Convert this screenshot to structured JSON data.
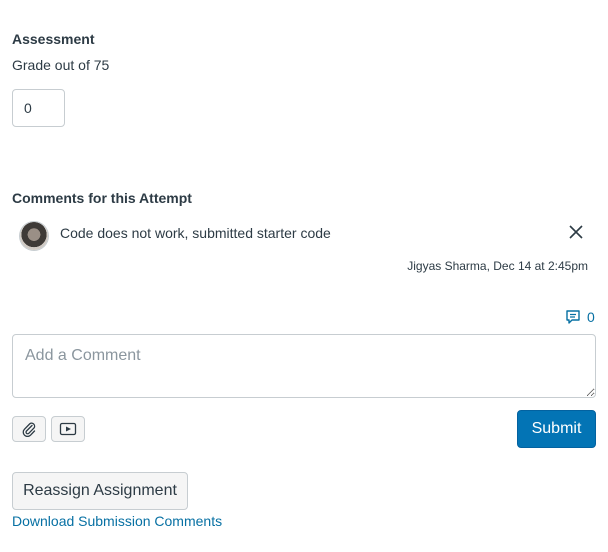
{
  "assessment": {
    "title": "Assessment",
    "grade_label": "Grade out of 75",
    "grade_value": "0"
  },
  "comments": {
    "title": "Comments for this Attempt",
    "items": [
      {
        "text": "Code does not work, submitted starter code",
        "meta": "Jigyas Sharma, Dec 14 at 2:45pm",
        "avatar_icon": "user-avatar",
        "delete_icon": "close-icon"
      }
    ],
    "count": "0",
    "count_icon": "comment-bubble-icon"
  },
  "composer": {
    "placeholder": "Add a Comment",
    "attach_icon": "paperclip-icon",
    "media_icon": "media-icon",
    "submit_label": "Submit"
  },
  "actions": {
    "reassign_label": "Reassign Assignment",
    "download_link": "Download Submission Comments"
  },
  "colors": {
    "accent": "#0374b5",
    "link": "#0770a3",
    "text": "#2d3b45",
    "border": "#c7cdd1"
  }
}
